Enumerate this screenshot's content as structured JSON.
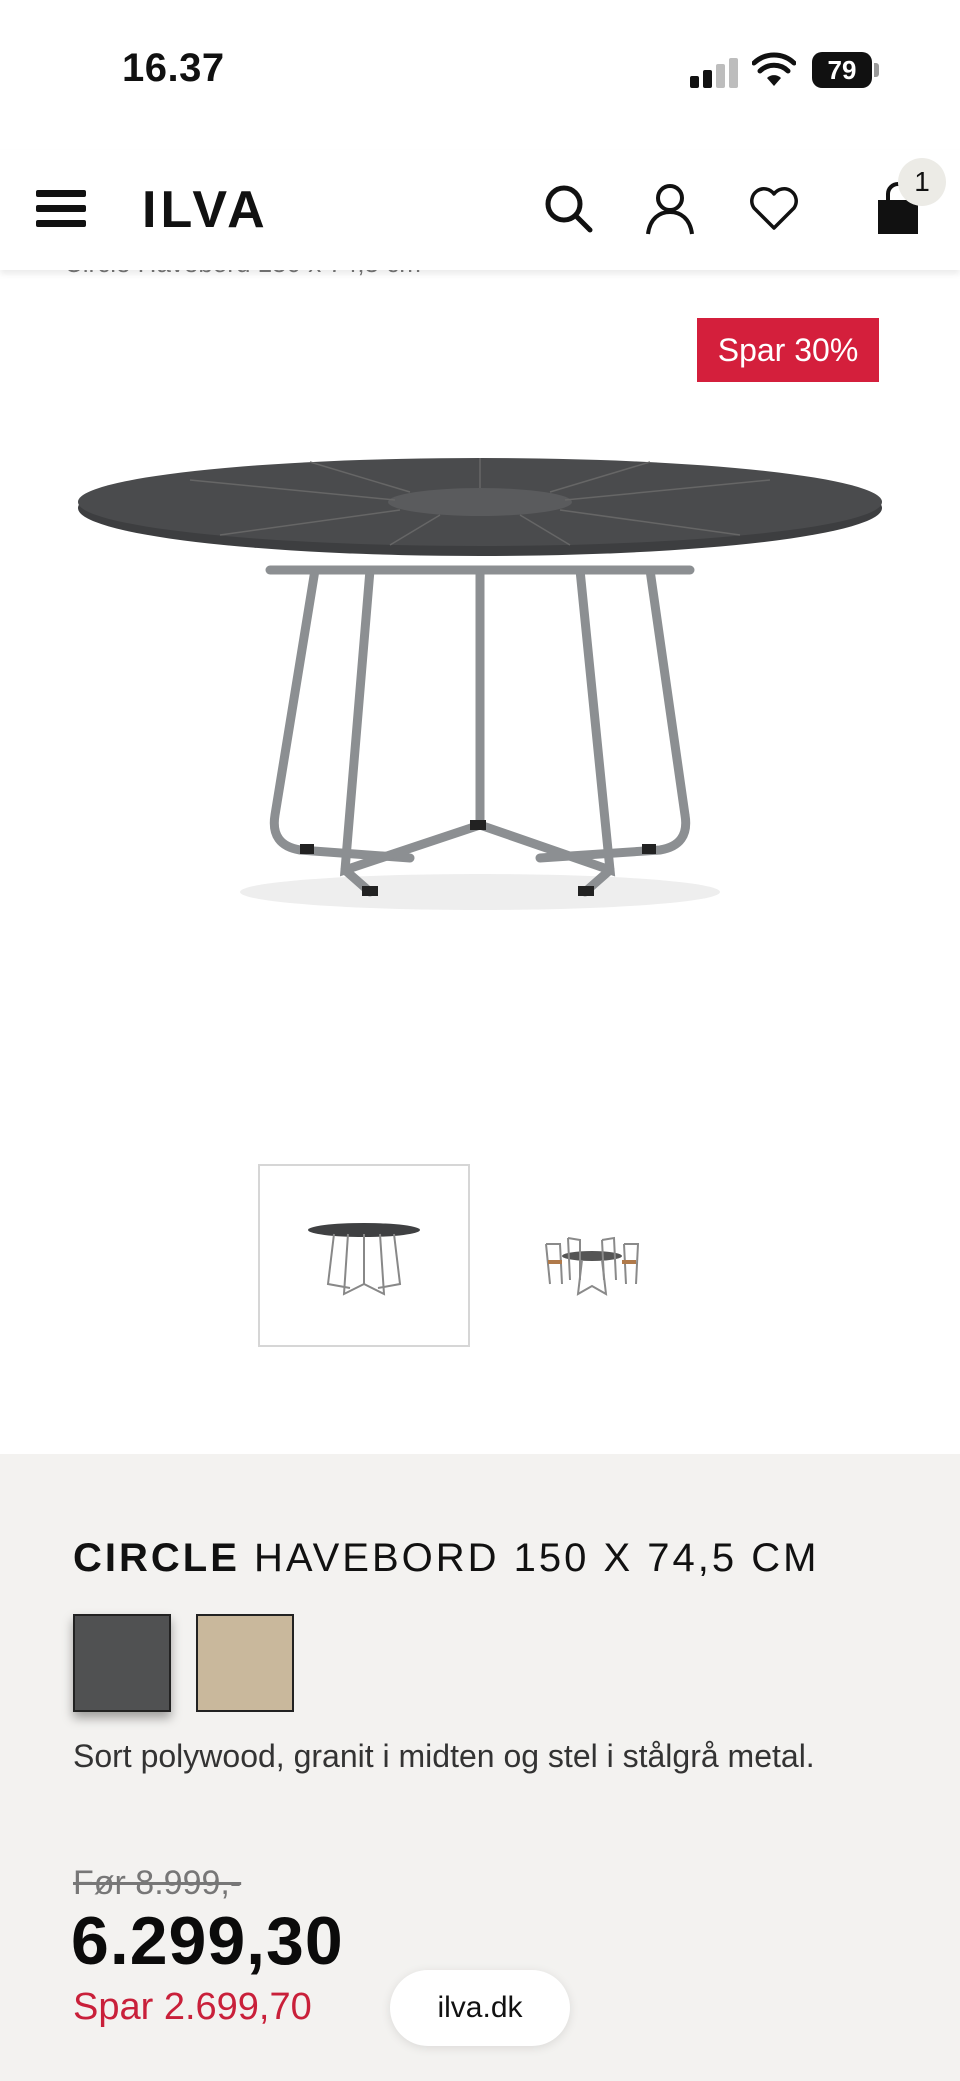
{
  "status_bar": {
    "time": "16.37",
    "battery_level": "79",
    "icons": [
      "cellular-signal-icon",
      "wifi-icon",
      "battery-icon"
    ]
  },
  "header": {
    "logo": "ILVA",
    "icons": [
      "menu-icon",
      "search-icon",
      "user-icon",
      "heart-icon",
      "cart-icon"
    ],
    "cart_count": "1"
  },
  "breadcrumb": "Circle Havebord 150 x 74,5 cm",
  "product": {
    "badge": "Spar 30%",
    "title_brand": "CIRCLE",
    "title_rest": " HAVEBORD 150 X 74,5 CM",
    "swatches": [
      {
        "color": "#505152",
        "selected": true
      },
      {
        "color": "#c9b89c",
        "selected": false
      }
    ],
    "description": "Sort polywood, granit i midten og stel i stålgrå metal.",
    "old_price": "Før 8.999,-",
    "price": "6.299,30",
    "savings": "Spar 2.699,70"
  },
  "colors": {
    "accent_red": "#d41f3c",
    "panel_bg": "#f3f2f0"
  },
  "browser": {
    "url": "ilva.dk"
  }
}
